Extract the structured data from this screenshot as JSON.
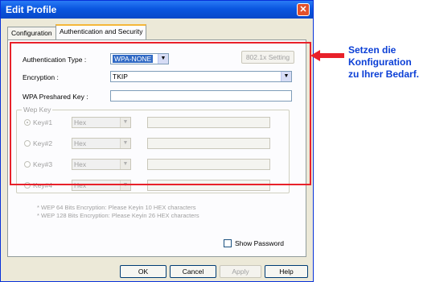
{
  "window": {
    "title": "Edit Profile"
  },
  "tabs": [
    {
      "label": "Configuration"
    },
    {
      "label": "Authentication and Security"
    }
  ],
  "auth": {
    "type_label": "Authentication Type :",
    "type_value": "WPA-NONE",
    "setting_button": "802.1x Setting"
  },
  "encryption": {
    "label": "Encryption :",
    "value": "TKIP"
  },
  "wpa": {
    "label": "WPA Preshared Key :",
    "value": ""
  },
  "wep": {
    "legend": "Wep Key",
    "keys": [
      {
        "label": "Key#1",
        "format": "Hex",
        "selected": true
      },
      {
        "label": "Key#2",
        "format": "Hex",
        "selected": false
      },
      {
        "label": "Key#3",
        "format": "Hex",
        "selected": false
      },
      {
        "label": "Key#4",
        "format": "Hex",
        "selected": false
      }
    ]
  },
  "notes": [
    "* WEP 64 Bits Encryption:   Please Keyin 10 HEX characters",
    "* WEP 128 Bits Encryption:   Please Keyin 26 HEX characters"
  ],
  "show_password": {
    "label": "Show Password",
    "checked": false
  },
  "buttons": {
    "ok": "OK",
    "cancel": "Cancel",
    "apply": "Apply",
    "help": "Help"
  },
  "annotation": {
    "lines": [
      "Setzen die",
      "Konfiguration",
      "zu Ihrer Bedarf."
    ]
  },
  "colors": {
    "highlight": "#e8212a",
    "annotation": "#0b3fd6",
    "title_bar": "#0a56e0"
  },
  "icons": {
    "close": "close-icon",
    "dropdown": "chevron-down-icon",
    "arrow": "left-arrow-icon"
  }
}
